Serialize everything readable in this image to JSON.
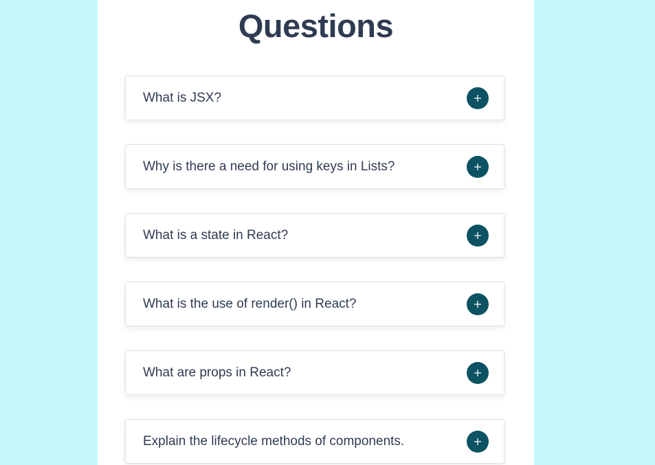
{
  "page": {
    "title": "Questions"
  },
  "questions": [
    {
      "label": "What is JSX?",
      "toggle_icon": "plus-icon"
    },
    {
      "label": "Why is there a need for using keys in Lists?",
      "toggle_icon": "plus-icon"
    },
    {
      "label": "What is a state in React?",
      "toggle_icon": "plus-icon"
    },
    {
      "label": "What is the use of render() in React?",
      "toggle_icon": "plus-icon"
    },
    {
      "label": "What are props in React?",
      "toggle_icon": "plus-icon"
    },
    {
      "label": "Explain the lifecycle methods of components.",
      "toggle_icon": "plus-icon"
    }
  ],
  "colors": {
    "background": "#c4f8fd",
    "panel": "#ffffff",
    "text": "#2f3b52",
    "toggle": "#0c5262"
  }
}
